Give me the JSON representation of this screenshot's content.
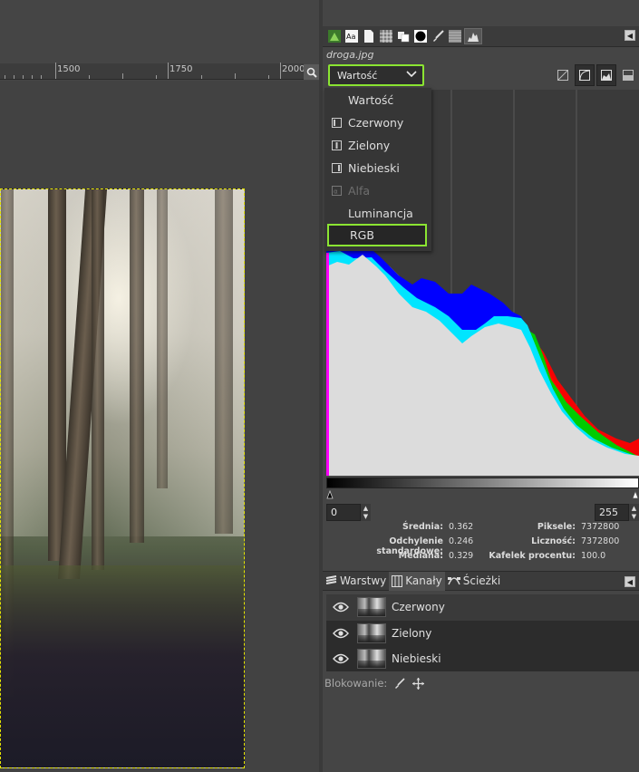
{
  "ruler": {
    "labels": [
      "1500",
      "1750",
      "2000"
    ]
  },
  "dock": {
    "image_name": "droga.jpg",
    "tab_icons": [
      "gimp-logo-icon",
      "font-icon",
      "document-icon",
      "pattern-icon",
      "clipboard-icon",
      "circle-brush-icon",
      "paintbrush-icon",
      "gradient-icon",
      "histogram-icon"
    ]
  },
  "histogram": {
    "channel_selected": "Wartość",
    "range_min": "0",
    "range_max": "255",
    "mode_buttons": [
      "linear-histogram-icon",
      "logarithmic-histogram-icon",
      "histogram-linear-mode-icon",
      "histogram-log-mode-icon"
    ],
    "stats": {
      "mean_label": "Średnia:",
      "mean_value": "0.362",
      "std_label": "Odchylenie standardowe:",
      "std_value": "0.246",
      "median_label": "Mediana:",
      "median_value": "0.329",
      "pixels_label": "Piksele:",
      "pixels_value": "7372800",
      "count_label": "Liczność:",
      "count_value": "7372800",
      "percentile_label": "Kafelek procentu:",
      "percentile_value": "100.0"
    }
  },
  "dropdown": {
    "items": [
      {
        "label": "Wartość",
        "icon": "",
        "disabled": false
      },
      {
        "label": "Czerwony",
        "icon": "red-channel-icon",
        "disabled": false
      },
      {
        "label": "Zielony",
        "icon": "green-channel-icon",
        "disabled": false
      },
      {
        "label": "Niebieski",
        "icon": "blue-channel-icon",
        "disabled": false
      },
      {
        "label": "Alfa",
        "icon": "alpha-channel-icon",
        "disabled": true
      },
      {
        "label": "Luminancja",
        "icon": "",
        "disabled": false
      },
      {
        "label": "RGB",
        "icon": "",
        "disabled": false
      }
    ]
  },
  "lower_dock": {
    "tabs": [
      {
        "label": "Warstwy",
        "icon": "layers-icon"
      },
      {
        "label": "Kanały",
        "icon": "channels-icon"
      },
      {
        "label": "Ścieżki",
        "icon": "paths-icon"
      }
    ],
    "channels": [
      {
        "label": "Czerwony",
        "visible": true
      },
      {
        "label": "Zielony",
        "visible": true
      },
      {
        "label": "Niebieski",
        "visible": true
      }
    ],
    "lock_label": "Blokowanie:"
  },
  "colors": {
    "highlight_outline": "#8be532",
    "selection_border": "#e6e600",
    "histogram_fill": "#dcdcdc",
    "hist_red": "#ff0000",
    "hist_yellow": "#ffff00",
    "hist_blue": "#0000ff",
    "hist_cyan": "#00e5ff",
    "hist_green": "#00cc00",
    "hist_magenta": "#ff00ff"
  }
}
